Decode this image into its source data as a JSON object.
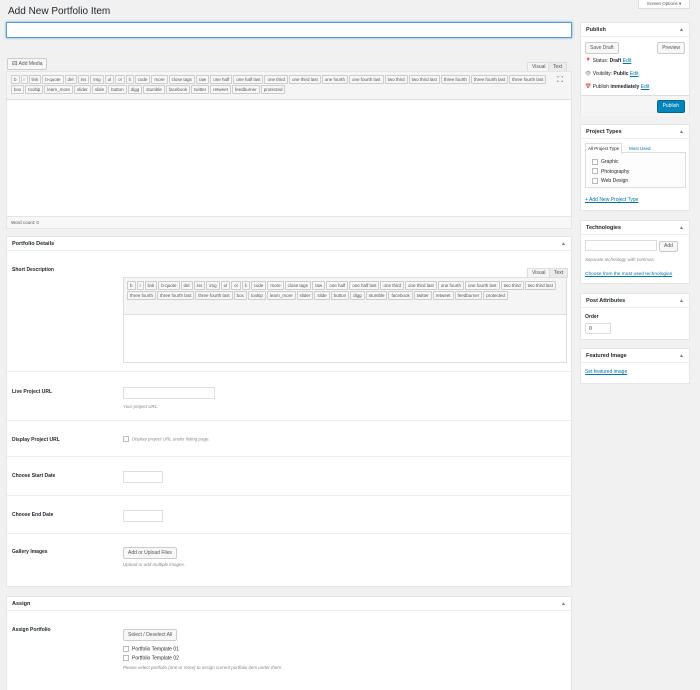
{
  "page": {
    "title": "Add New Portfolio Item",
    "screen_options": "Screen Options",
    "screen_options_arrow": "▾"
  },
  "editor": {
    "add_media": "Add Media",
    "tab_visual": "Visual",
    "tab_text": "Text",
    "word_count": "Word count: 0",
    "quicktags": [
      "b",
      "i",
      "link",
      "b-quote",
      "del",
      "ins",
      "img",
      "ul",
      "ol",
      "li",
      "code",
      "more",
      "close tags",
      "raw",
      "one half",
      "one half last",
      "one third",
      "one third last",
      "one fourth",
      "one fourth last",
      "two third",
      "two third last",
      "three fourth",
      "three fourth last",
      "three fourth last",
      "box",
      "tooltip",
      "learn_more",
      "slider",
      "slide",
      "button",
      "digg",
      "stumble",
      "facebook",
      "twitter",
      "retweet",
      "feedburner",
      "protected"
    ]
  },
  "details": {
    "title": "Portfolio Details",
    "arrow": "▲",
    "short_desc": "Short Description",
    "tab_visual": "Visual",
    "tab_text": "Text",
    "quicktags": [
      "b",
      "i",
      "link",
      "b-quote",
      "del",
      "ins",
      "img",
      "ul",
      "ol",
      "li",
      "code",
      "more",
      "close tags",
      "raw",
      "one half",
      "one half last",
      "one third",
      "one third last",
      "one fourth",
      "one fourth last",
      "two third",
      "two third last",
      "three fourth",
      "three fourth last",
      "three fourth last",
      "box",
      "tooltip",
      "learn_more",
      "slider",
      "slide",
      "button",
      "digg",
      "stumble",
      "facebook",
      "twitter",
      "retweet",
      "feedburner",
      "protected"
    ],
    "live_url_label": "Live Project URL",
    "live_url_desc": "Your project URL.",
    "display_url_label": "Display Project URL",
    "display_url_desc": "Display project URL under listing page.",
    "start_label": "Choose Start Date",
    "end_label": "Choose End Date",
    "gallery_label": "Gallery Images",
    "gallery_btn": "Add or Upload Files",
    "gallery_desc": "Upload or add multiple images."
  },
  "assign": {
    "title": "Assign",
    "arrow": "▲",
    "label": "Assign Portfolio",
    "select_btn": "Select / Deselect All",
    "templates": [
      "Portfolio Template 01",
      "Portfolio Template 02"
    ],
    "desc": "Please select portfolio (one or more) to assign current portfolio item under them."
  },
  "publish": {
    "title": "Publish",
    "arrow": "▲",
    "save_draft": "Save Draft",
    "preview": "Preview",
    "status_label": "Status:",
    "status_value": "Draft",
    "visibility_label": "Visibility:",
    "visibility_value": "Public",
    "schedule_label": "Publish",
    "schedule_value": "immediately",
    "edit": "Edit",
    "publish_btn": "Publish"
  },
  "types": {
    "title": "Project Types",
    "arrow": "▲",
    "tab_all": "All Project Type",
    "tab_most": "Most Used",
    "items": [
      "Graphic",
      "Photography",
      "Web Design"
    ],
    "add_new": "+ Add New Project Type"
  },
  "tech": {
    "title": "Technologies",
    "arrow": "▲",
    "add": "Add",
    "desc": "Separate technology with commas.",
    "choose": "Choose from the most used technologies"
  },
  "attributes": {
    "title": "Post Attributes",
    "arrow": "▲",
    "order_label": "Order",
    "order_value": "0"
  },
  "featured": {
    "title": "Featured Image",
    "arrow": "▲",
    "link": "Set featured image"
  },
  "colors": {
    "accent": "#0073aa",
    "publish": "#0085ba"
  }
}
